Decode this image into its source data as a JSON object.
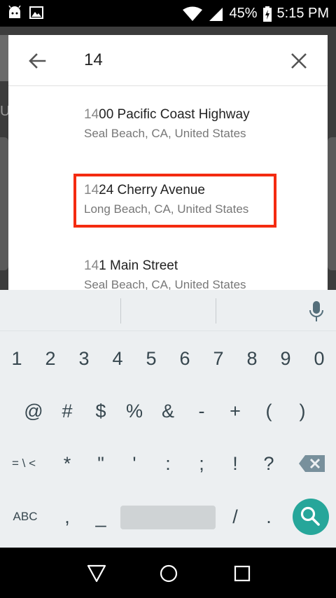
{
  "status_bar": {
    "battery": "45%",
    "time": "5:15 PM",
    "icons": [
      "android-debug-icon",
      "image-notification-icon",
      "wifi-icon",
      "cell-signal-icon",
      "battery-charging-icon"
    ]
  },
  "search": {
    "query": "14",
    "back_icon": "back-arrow-icon",
    "clear_icon": "close-icon"
  },
  "results": [
    {
      "match": "14",
      "rest": "00 Pacific Coast Highway",
      "subtitle": "Seal Beach, CA, United States"
    },
    {
      "match": "14",
      "rest": "24 Cherry Avenue",
      "subtitle": "Long Beach, CA, United States",
      "highlighted": true
    },
    {
      "match": "14",
      "rest": "1 Main Street",
      "subtitle": "Seal Beach, CA, United States"
    }
  ],
  "keyboard": {
    "row1": [
      "1",
      "2",
      "3",
      "4",
      "5",
      "6",
      "7",
      "8",
      "9",
      "0"
    ],
    "row2": [
      "@",
      "#",
      "$",
      "%",
      "&",
      "-",
      "+",
      "(",
      ")"
    ],
    "row3": [
      "= \\ <",
      "*",
      "\"",
      "'",
      ":",
      ";",
      "!",
      "?"
    ],
    "row4": {
      "abc": "ABC",
      "comma": ",",
      "underscore": "_",
      "slash": "/",
      "period": "."
    },
    "icons": [
      "mic-icon",
      "backspace-icon",
      "search-icon"
    ]
  },
  "nav_bar": {
    "icons": [
      "back-triangle-icon",
      "home-circle-icon",
      "recents-square-icon"
    ]
  },
  "colors": {
    "accent": "#26a69a",
    "highlight_box": "#f42b10",
    "keyboard_bg": "#eceff1"
  }
}
